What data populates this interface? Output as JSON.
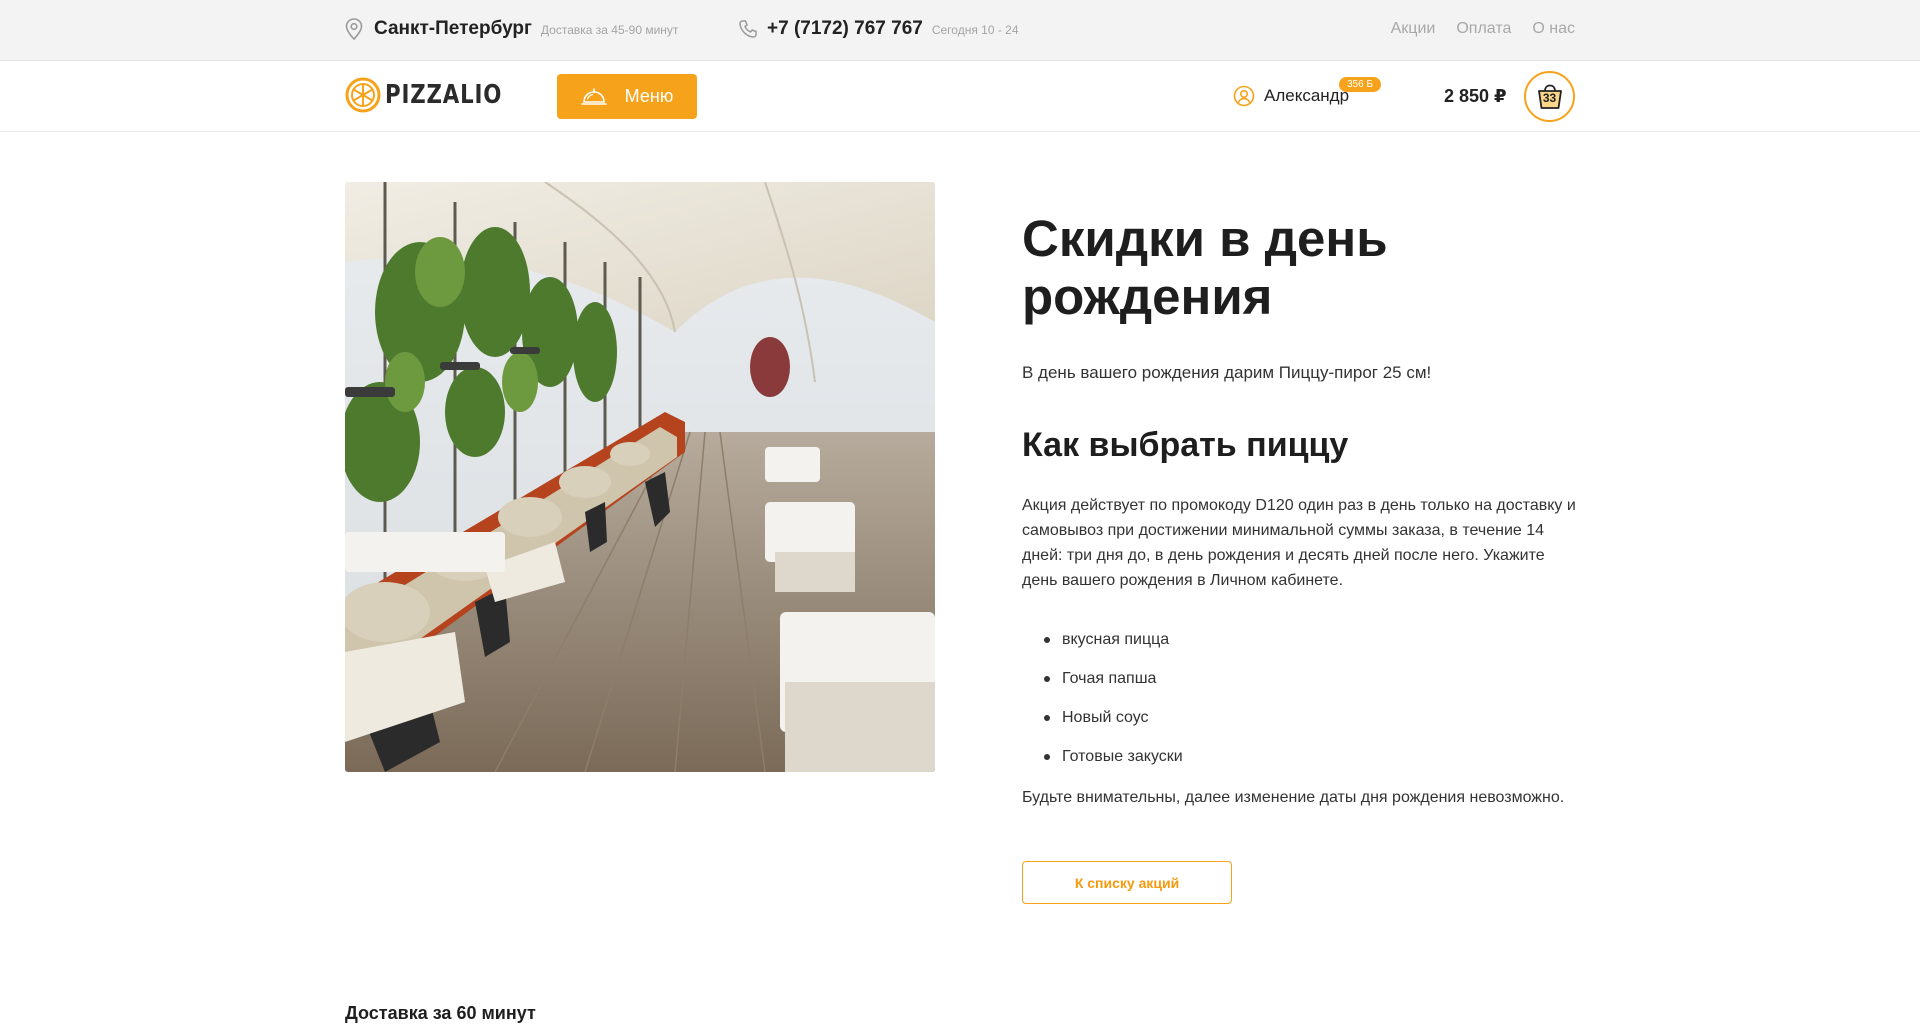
{
  "topbar": {
    "city": "Санкт-Петербург",
    "delivery_note": "Доставка за 45-90 минут",
    "phone": "+7 (7172) 767 767",
    "hours": "Сегодня 10 - 24",
    "links": [
      "Акции",
      "Оплата",
      "О нас"
    ]
  },
  "header": {
    "logo_text": "PIZZALIO",
    "menu_label": "Меню",
    "user_name": "Александр",
    "bonus": "356 Б",
    "cart_total": "2 850 ₽",
    "cart_count": "33"
  },
  "promo": {
    "title": "Скидки в день рождения",
    "lead": "В день вашего рождения дарим Пиццу-пирог 25 см!",
    "subtitle": "Как выбрать пиццу",
    "paragraph": "Акция действует по промокоду D120 один раз в день только на доставку и самовывоз при достижении минимальной суммы заказа, в течение 14 дней: три дня до, в день рождения и десять дней после него. Укажите день вашего рождения в Личном кабинете.",
    "items": [
      "вкусная пицца",
      "Гочая папша",
      "Новый соус",
      "Готовые закуски"
    ],
    "warning": "Будьте внимательны, далее изменение даты дня рождения невозможно.",
    "back_button": "К списку акций",
    "image_icon": "restaurant-terrace-photo"
  },
  "footer": {
    "title": "Доставка за 60 минут"
  },
  "colors": {
    "accent": "#f7a21b",
    "topbar_bg": "#f3f3f3",
    "text": "#222222",
    "muted": "#a8a8a8"
  }
}
